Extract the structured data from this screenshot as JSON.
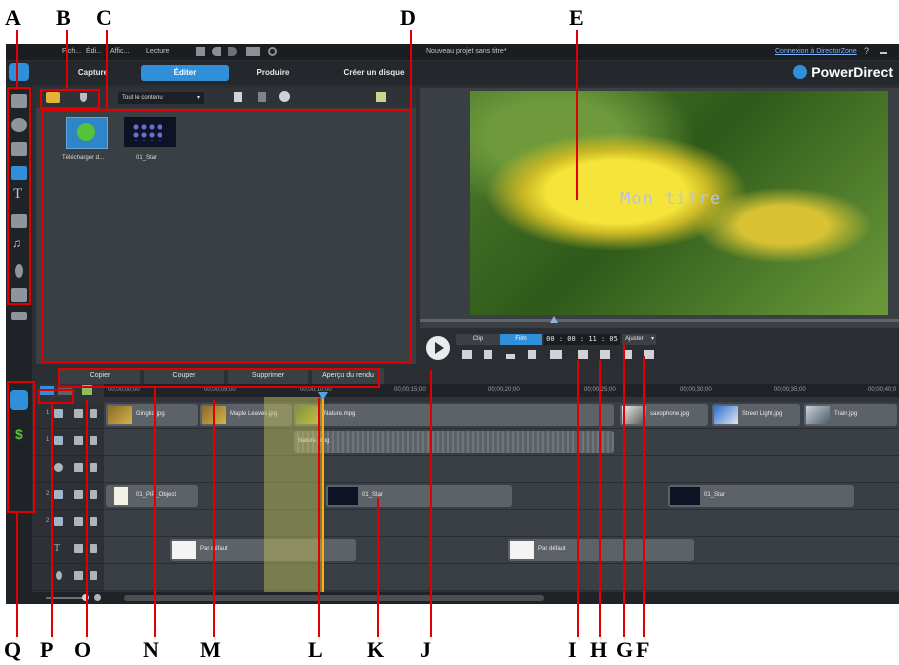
{
  "callouts": [
    "A",
    "B",
    "C",
    "D",
    "E",
    "Q",
    "P",
    "O",
    "N",
    "M",
    "L",
    "K",
    "J",
    "I",
    "H",
    "G",
    "F"
  ],
  "menu": {
    "items": [
      "Fich...",
      "Édi...",
      "Affic...",
      "Lecture"
    ],
    "project_title": "Nouveau projet sans titre*",
    "directorzone_link": "Connexion à DirectorZone",
    "help": "?"
  },
  "modes": {
    "capture": "Capture",
    "edit": "Éditer",
    "produce": "Produire",
    "disc": "Créer un disque"
  },
  "brand": "PowerDirect",
  "library": {
    "filter": "Tout le contenu",
    "items": [
      {
        "label": "Télécharger d..."
      },
      {
        "label": "01_Star"
      }
    ]
  },
  "preview": {
    "overlay_title": "Mon titre",
    "clip_tab": "Clip",
    "film_tab": "Film",
    "timecode": "00 : 00 : 11 : 05",
    "fit": "Ajuster"
  },
  "edit_buttons": {
    "copy": "Copier",
    "cut": "Couper",
    "delete": "Supprimer",
    "render_preview": "Aperçu du rendu"
  },
  "ruler": [
    "00;00;00;00",
    "00;00;05;00",
    "00;00;10;00",
    "00;00;15;00",
    "00;00;20;00",
    "00;00;25;00",
    "00;00;30;00",
    "00;00;35;00",
    "00;00;40;0"
  ],
  "tracks": {
    "video1": [
      "Gingko.jpg",
      "Maple Leaves.jpg",
      "Nature.mpg",
      "saxophone.jpg",
      "Street Light.jpg",
      "Train.jpg"
    ],
    "audio1": [
      "Nature.mpg"
    ],
    "pip": [
      "01_PiP_Object",
      "01_Star",
      "01_Star"
    ],
    "title": [
      "Par défaut",
      "Par défaut"
    ],
    "track_numbers": [
      "1",
      "1",
      "2",
      "2"
    ]
  },
  "colors": {
    "accent": "#2f8fd8",
    "callout_red": "#e00000",
    "app_bg": "#2b2f33"
  }
}
